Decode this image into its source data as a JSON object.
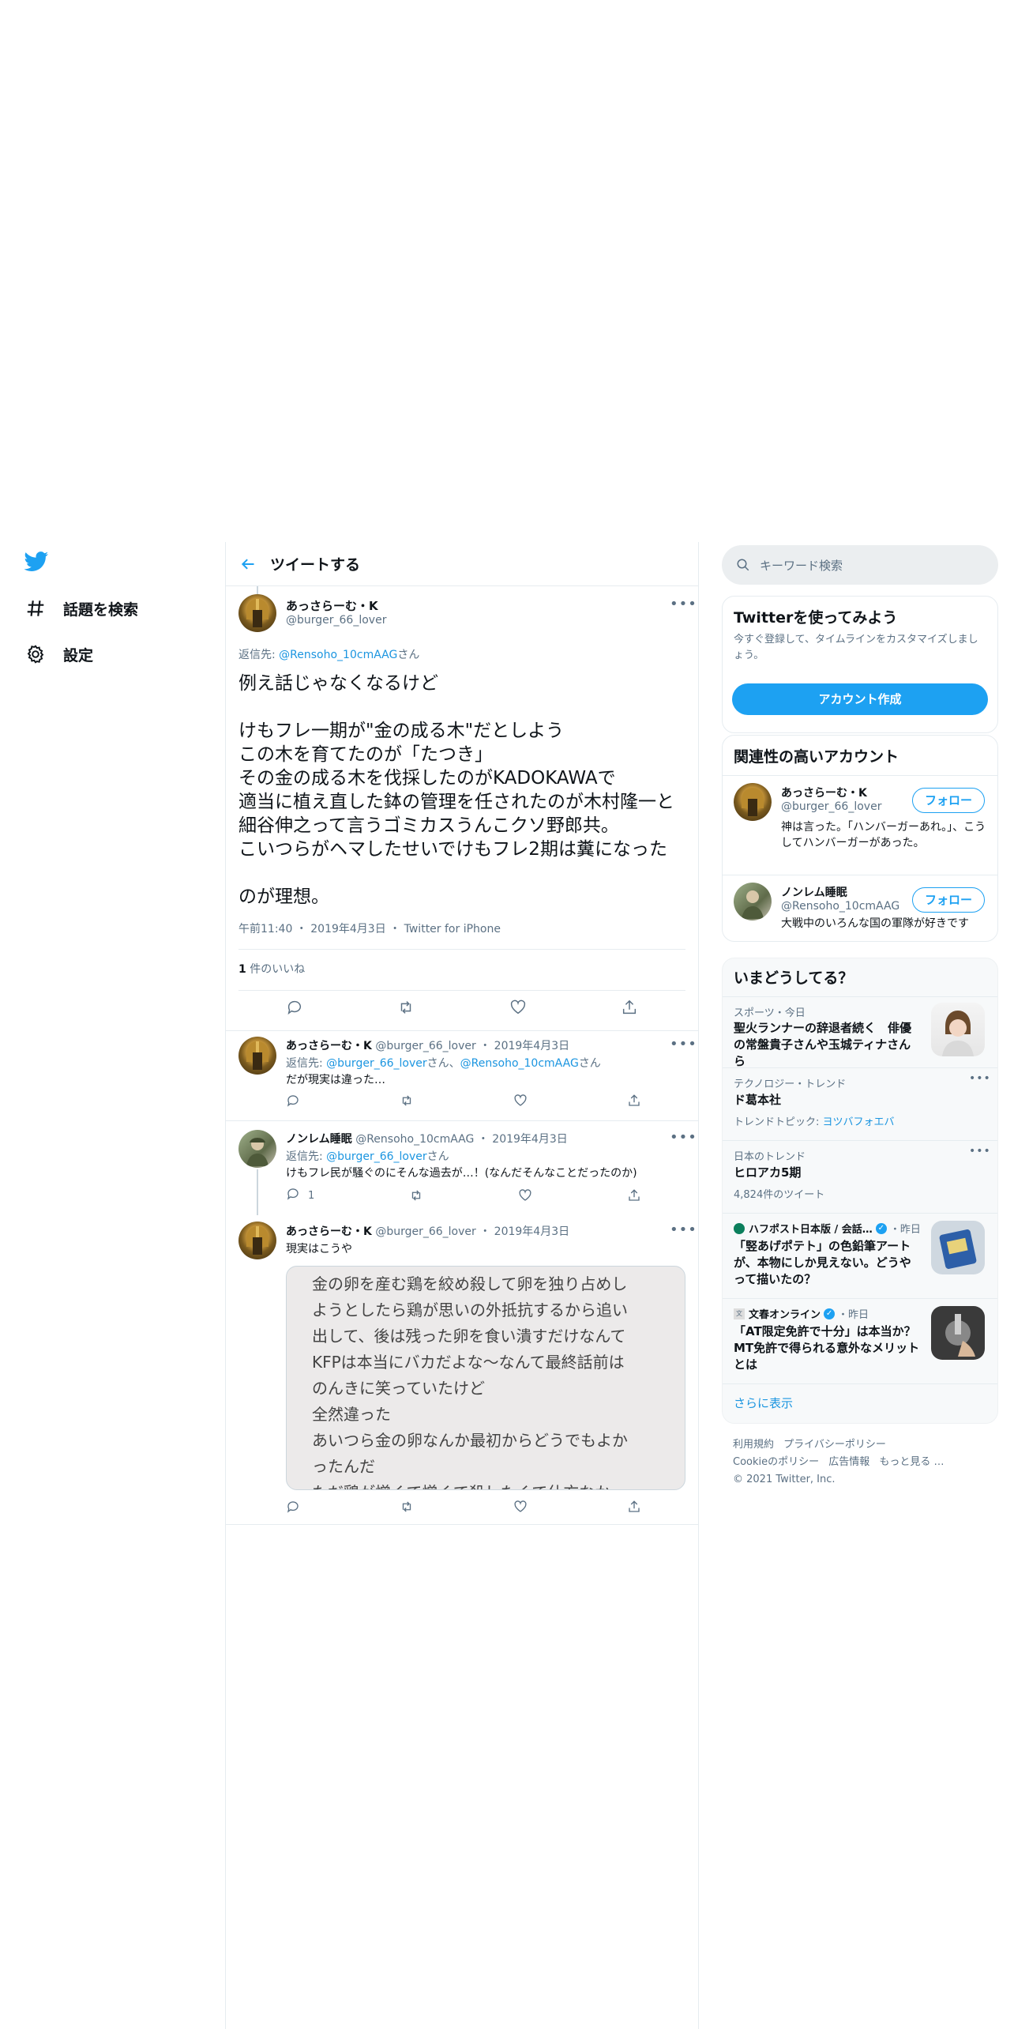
{
  "nav": {
    "explore_label": "話題を検索",
    "settings_label": "設定"
  },
  "header": {
    "title": "ツイートする"
  },
  "main_tweet": {
    "display_name": "あっさらーむ・K",
    "handle": "@burger_66_lover",
    "reply_prefix": "返信先:",
    "reply_to": "@Rensoho_10cmAAG",
    "reply_suffix": "さん",
    "text": "例え話じゃなくなるけど\n\nけもフレ一期が\"金の成る木\"だとしよう\nこの木を育てたのが「たつき」\nその金の成る木を伐採したのがKADOKAWAで\n適当に植え直した鉢の管理を任されたのが木村隆一と\n細谷伸之って言うゴミカスうんこクソ野郎共。\nこいつらがヘマしたせいでけもフレ2期は糞になった\n\nのが理想。",
    "time": "午前11:40",
    "date": "2019年4月3日",
    "source": "Twitter for iPhone",
    "like_count": "1",
    "like_label": "件のいいね"
  },
  "replies": [
    {
      "display_name": "あっさらーむ・K",
      "handle": "@burger_66_lover",
      "date": "2019年4月3日",
      "reply_prefix": "返信先:",
      "reply_to_1": "@burger_66_lover",
      "reply_mid": "さん、",
      "reply_to_2": "@Rensoho_10cmAAG",
      "reply_suffix": "さん",
      "text": "だが現実は違った…",
      "reply_count": ""
    },
    {
      "display_name": "ノンレム睡眠",
      "handle": "@Rensoho_10cmAAG",
      "date": "2019年4月3日",
      "reply_prefix": "返信先:",
      "reply_to_1": "@burger_66_lover",
      "reply_suffix": "さん",
      "text": "けもフレ民が騒ぐのにそんな過去が…！(なんだそんなことだったのか)",
      "reply_count": "1"
    },
    {
      "display_name": "あっさらーむ・K",
      "handle": "@burger_66_lover",
      "date": "2019年4月3日",
      "text": "現実はこうや",
      "image_text": "金の卵を産む鶏を絞め殺して卵を独り占めし\nようとしたら鶏が思いの外抵抗するから追い\n出して、後は残った卵を食い潰すだけなんて\nKFPは本当にバカだよな〜なんて最終話前は\nのんきに笑っていたけど\n全然違った\nあいつら金の卵なんか最初からどうでもよか\nったんだ\nただ鶏が憎くて憎くて殺したくて仕方なかっ"
    }
  ],
  "search": {
    "placeholder": "キーワード検索"
  },
  "signup": {
    "title": "Twitterを使ってみよう",
    "desc": "今すぐ登録して、タイムラインをカスタマイズしましょう。",
    "button": "アカウント作成"
  },
  "related": {
    "title": "関連性の高いアカウント",
    "accounts": [
      {
        "name": "あっさらーむ・K",
        "handle": "@burger_66_lover",
        "bio": "神は言った。「ハンバーガーあれ。」、こうしてハンバーガーがあった。",
        "follow": "フォロー"
      },
      {
        "name": "ノンレム睡眠",
        "handle": "@Rensoho_10cmAAG",
        "bio": "大戦中のいろんな国の軍隊が好きです",
        "follow": "フォロー"
      }
    ]
  },
  "trends": {
    "title": "いまどうしてる？",
    "items": [
      {
        "meta": "スポーツ・今日",
        "title": "聖火ランナーの辞退者続く　俳優の常盤貴子さんや玉城ティナさんら"
      },
      {
        "meta": "テクノロジー・トレンド",
        "title": "ド葛本社",
        "extra_prefix": "トレンドトピック:",
        "extra_link": "ヨツバフォエバ"
      },
      {
        "meta": "日本のトレンド",
        "title": "ヒロアカ5期",
        "extra": "4,824件のツイート"
      },
      {
        "source": "ハフポスト日本版 / 会話…",
        "meta": "・昨日",
        "title": "「竪あげポテト」の色鉛筆アートが、本物にしか見えない。どうやって描いたの？"
      },
      {
        "source": "文春オンライン",
        "meta": "・昨日",
        "title": "「AT限定免許で十分」は本当か？　MT免許で得られる意外なメリットとは"
      }
    ],
    "show_more": "さらに表示"
  },
  "footer": {
    "line1": [
      "利用規約",
      "プライバシーポリシー"
    ],
    "line2": [
      "Cookieのポリシー",
      "広告情報",
      "もっと見る …"
    ],
    "copyright": "© 2021 Twitter, Inc."
  },
  "colors": {
    "accent": "#1da1f2",
    "link": "#1b95e0",
    "muted": "#5b7083",
    "border": "#e6ecf0"
  }
}
